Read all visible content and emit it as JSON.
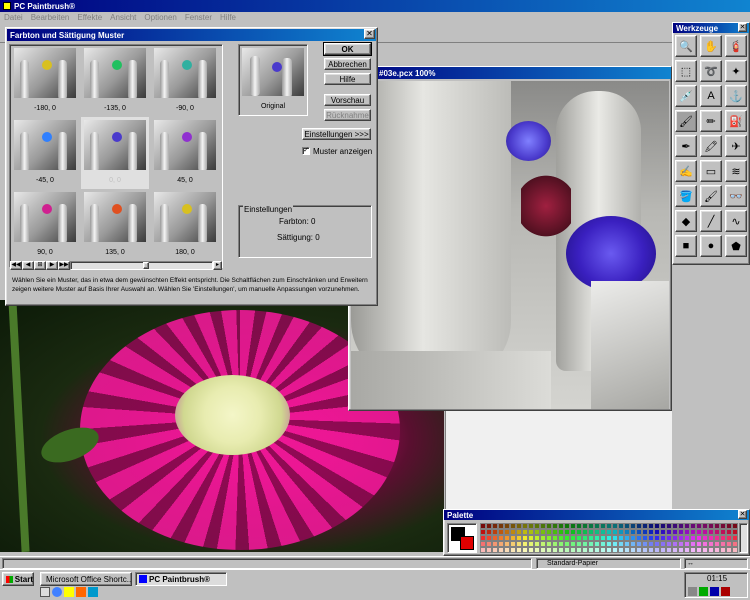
{
  "app": {
    "title": "PC Paintbrush®",
    "menu": [
      "Datei",
      "Bearbeiten",
      "Effekte",
      "Ansicht",
      "Optionen",
      "Fenster",
      "Hilfe"
    ]
  },
  "dialog": {
    "title": "Farbton und Sättigung Muster",
    "thumbs": [
      "-180, 0",
      "-135, 0",
      "-90, 0",
      "-45, 0",
      "0, 0",
      "45, 0",
      "90, 0",
      "135, 0",
      "180, 0"
    ],
    "selected_index": 4,
    "original_label": "Original",
    "buttons": {
      "ok": "OK",
      "cancel": "Abbrechen",
      "help": "Hilfe",
      "preview": "Vorschau",
      "undo": "Rücknahme",
      "settings": "Einstellungen >>>"
    },
    "show_pattern_label": "Muster anzeigen",
    "show_pattern_checked": true,
    "settings_group_title": "Einstellungen",
    "hue_label": "Farbton: 0",
    "saturation_label": "Sättigung: 0",
    "help_text": "Wählen Sie ein Muster, das in etwa dem gewünschten Effekt entspricht.  Die Schaltflächen zum Einschränken und Erweitern zeigen weitere Muster auf Basis Ihrer Auswahl an. Wählen Sie 'Einstellungen', um manuelle Anpassungen vorzunehmen."
  },
  "doc_window": {
    "title": "#03e.pcx  100%"
  },
  "toolbox": {
    "title": "Werkzeuge",
    "tools": [
      {
        "name": "zoom-icon",
        "glyph": "🔍"
      },
      {
        "name": "hand-icon",
        "glyph": "✋"
      },
      {
        "name": "spray-icon",
        "glyph": "🧯"
      },
      {
        "name": "rect-select-icon",
        "glyph": "⬚"
      },
      {
        "name": "lasso-icon",
        "glyph": "➰"
      },
      {
        "name": "magic-wand-icon",
        "glyph": "✦"
      },
      {
        "name": "eyedropper-icon",
        "glyph": "💉"
      },
      {
        "name": "text-icon",
        "glyph": "A"
      },
      {
        "name": "clone-icon",
        "glyph": "⚓"
      },
      {
        "name": "brush-icon",
        "glyph": "🖌"
      },
      {
        "name": "pencil-icon",
        "glyph": "✏"
      },
      {
        "name": "fill-icon",
        "glyph": "⛽"
      },
      {
        "name": "pen-icon",
        "glyph": "✒"
      },
      {
        "name": "marker-icon",
        "glyph": "🖍"
      },
      {
        "name": "airbrush-icon",
        "glyph": "✈"
      },
      {
        "name": "crayon-icon",
        "glyph": "✍"
      },
      {
        "name": "eraser-icon",
        "glyph": "▭"
      },
      {
        "name": "smudge-icon",
        "glyph": "≋"
      },
      {
        "name": "bucket-icon",
        "glyph": "🪣"
      },
      {
        "name": "brush2-icon",
        "glyph": "🖌"
      },
      {
        "name": "glasses-icon",
        "glyph": "👓"
      },
      {
        "name": "color-replace-icon",
        "glyph": "◆"
      },
      {
        "name": "line-icon",
        "glyph": "╱"
      },
      {
        "name": "curve-icon",
        "glyph": "∿"
      },
      {
        "name": "rectangle-icon",
        "glyph": "■"
      },
      {
        "name": "ellipse-icon",
        "glyph": "●"
      },
      {
        "name": "polygon-icon",
        "glyph": "⬟"
      }
    ]
  },
  "palette": {
    "title": "Palette"
  },
  "statusbar": {
    "paper": "Standard-Papier"
  },
  "taskbar": {
    "start": "Start",
    "items": [
      "Microsoft Office Shortc...",
      "PC Paintbrush®"
    ],
    "clock": "01:15"
  },
  "colors": {
    "titlebar": "#000080",
    "desktop": "#c0c0c0"
  }
}
